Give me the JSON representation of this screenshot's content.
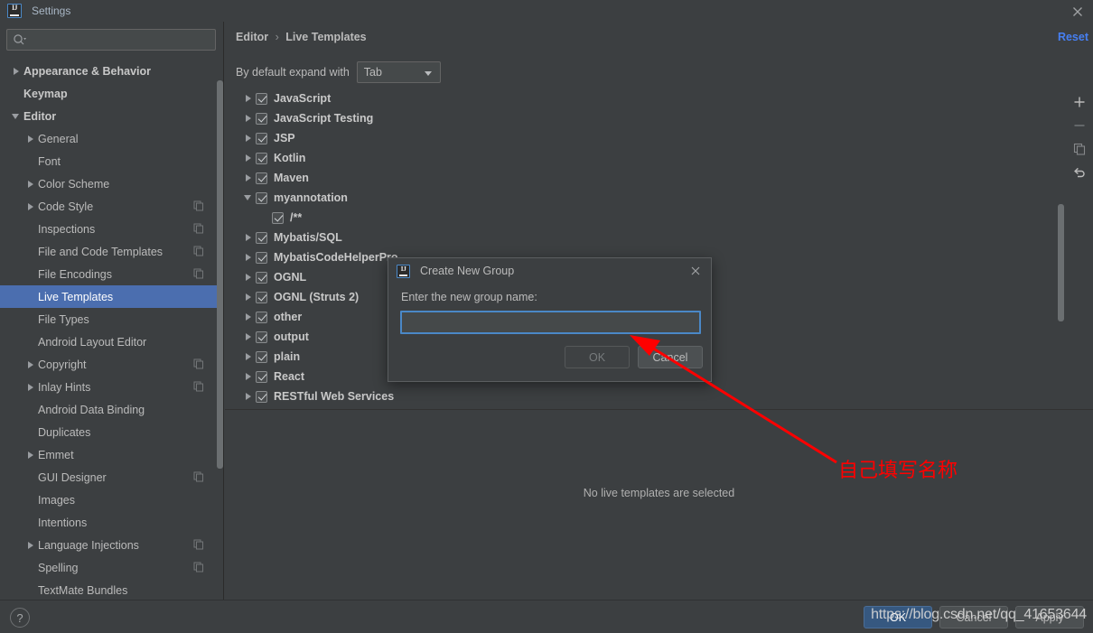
{
  "window": {
    "title": "Settings",
    "logo_icon": "intellij-idea-icon",
    "close_icon": "close-icon"
  },
  "sidebar": {
    "search": {
      "placeholder": "",
      "value": "",
      "icon": "search-icon"
    },
    "items": [
      {
        "label": "Appearance & Behavior",
        "arrow": "closed",
        "indent": 0,
        "bold": true,
        "selected": false,
        "copy": false
      },
      {
        "label": "Keymap",
        "arrow": "none",
        "indent": 0,
        "bold": true,
        "selected": false,
        "copy": false
      },
      {
        "label": "Editor",
        "arrow": "open",
        "indent": 0,
        "bold": true,
        "selected": false,
        "copy": false
      },
      {
        "label": "General",
        "arrow": "closed",
        "indent": 1,
        "bold": false,
        "selected": false,
        "copy": false
      },
      {
        "label": "Font",
        "arrow": "none",
        "indent": 1,
        "bold": false,
        "selected": false,
        "copy": false
      },
      {
        "label": "Color Scheme",
        "arrow": "closed",
        "indent": 1,
        "bold": false,
        "selected": false,
        "copy": false
      },
      {
        "label": "Code Style",
        "arrow": "closed",
        "indent": 1,
        "bold": false,
        "selected": false,
        "copy": true
      },
      {
        "label": "Inspections",
        "arrow": "none",
        "indent": 1,
        "bold": false,
        "selected": false,
        "copy": true
      },
      {
        "label": "File and Code Templates",
        "arrow": "none",
        "indent": 1,
        "bold": false,
        "selected": false,
        "copy": true
      },
      {
        "label": "File Encodings",
        "arrow": "none",
        "indent": 1,
        "bold": false,
        "selected": false,
        "copy": true
      },
      {
        "label": "Live Templates",
        "arrow": "none",
        "indent": 1,
        "bold": false,
        "selected": true,
        "copy": false
      },
      {
        "label": "File Types",
        "arrow": "none",
        "indent": 1,
        "bold": false,
        "selected": false,
        "copy": false
      },
      {
        "label": "Android Layout Editor",
        "arrow": "none",
        "indent": 1,
        "bold": false,
        "selected": false,
        "copy": false
      },
      {
        "label": "Copyright",
        "arrow": "closed",
        "indent": 1,
        "bold": false,
        "selected": false,
        "copy": true
      },
      {
        "label": "Inlay Hints",
        "arrow": "closed",
        "indent": 1,
        "bold": false,
        "selected": false,
        "copy": true
      },
      {
        "label": "Android Data Binding",
        "arrow": "none",
        "indent": 1,
        "bold": false,
        "selected": false,
        "copy": false
      },
      {
        "label": "Duplicates",
        "arrow": "none",
        "indent": 1,
        "bold": false,
        "selected": false,
        "copy": false
      },
      {
        "label": "Emmet",
        "arrow": "closed",
        "indent": 1,
        "bold": false,
        "selected": false,
        "copy": false
      },
      {
        "label": "GUI Designer",
        "arrow": "none",
        "indent": 1,
        "bold": false,
        "selected": false,
        "copy": true
      },
      {
        "label": "Images",
        "arrow": "none",
        "indent": 1,
        "bold": false,
        "selected": false,
        "copy": false
      },
      {
        "label": "Intentions",
        "arrow": "none",
        "indent": 1,
        "bold": false,
        "selected": false,
        "copy": false
      },
      {
        "label": "Language Injections",
        "arrow": "closed",
        "indent": 1,
        "bold": false,
        "selected": false,
        "copy": true
      },
      {
        "label": "Spelling",
        "arrow": "none",
        "indent": 1,
        "bold": false,
        "selected": false,
        "copy": true
      },
      {
        "label": "TextMate Bundles",
        "arrow": "none",
        "indent": 1,
        "bold": false,
        "selected": false,
        "copy": false
      }
    ]
  },
  "main": {
    "breadcrumb": {
      "parent": "Editor",
      "separator": "›",
      "current": "Live Templates"
    },
    "reset_label": "Reset",
    "expand_label": "By default expand with",
    "expand_value": "Tab",
    "empty_message": "No live templates are selected",
    "toolbar": [
      {
        "name": "add-button",
        "icon": "plus-icon",
        "enabled": true
      },
      {
        "name": "remove-button",
        "icon": "minus-icon",
        "enabled": false
      },
      {
        "name": "duplicate-button",
        "icon": "copy-icon",
        "enabled": false
      },
      {
        "name": "revert-button",
        "icon": "undo-icon",
        "enabled": true
      }
    ],
    "templates": [
      {
        "label": "JavaScript",
        "arrow": "closed",
        "checked": true,
        "indent": 0
      },
      {
        "label": "JavaScript Testing",
        "arrow": "closed",
        "checked": true,
        "indent": 0
      },
      {
        "label": "JSP",
        "arrow": "closed",
        "checked": true,
        "indent": 0
      },
      {
        "label": "Kotlin",
        "arrow": "closed",
        "checked": true,
        "indent": 0
      },
      {
        "label": "Maven",
        "arrow": "closed",
        "checked": true,
        "indent": 0
      },
      {
        "label": "myannotation",
        "arrow": "open",
        "checked": true,
        "indent": 0
      },
      {
        "label": "/**",
        "arrow": "none",
        "checked": true,
        "indent": 1
      },
      {
        "label": "Mybatis/SQL",
        "arrow": "closed",
        "checked": true,
        "indent": 0
      },
      {
        "label": "MybatisCodeHelperPro",
        "arrow": "closed",
        "checked": true,
        "indent": 0
      },
      {
        "label": "OGNL",
        "arrow": "closed",
        "checked": true,
        "indent": 0
      },
      {
        "label": "OGNL (Struts 2)",
        "arrow": "closed",
        "checked": true,
        "indent": 0
      },
      {
        "label": "other",
        "arrow": "closed",
        "checked": true,
        "indent": 0
      },
      {
        "label": "output",
        "arrow": "closed",
        "checked": true,
        "indent": 0
      },
      {
        "label": "plain",
        "arrow": "closed",
        "checked": true,
        "indent": 0
      },
      {
        "label": "React",
        "arrow": "closed",
        "checked": true,
        "indent": 0
      },
      {
        "label": "RESTful Web Services",
        "arrow": "closed",
        "checked": true,
        "indent": 0
      }
    ]
  },
  "dialog": {
    "title": "Create New Group",
    "logo_icon": "intellij-idea-icon",
    "close_icon": "close-icon",
    "prompt": "Enter the new group name:",
    "input_value": "",
    "input_placeholder": "",
    "ok_label": "OK",
    "cancel_label": "Cancel",
    "ok_enabled": false
  },
  "annotation": {
    "text": "自己填写名称",
    "color": "#ff0000",
    "arrow_icon": "arrow-pointer-icon"
  },
  "bottom": {
    "help_label": "?",
    "buttons": [
      {
        "label": "OK",
        "default": true
      },
      {
        "label": "Cancel",
        "default": false
      },
      {
        "label": "Apply",
        "default": false
      }
    ],
    "watermark": "https://blog.csdn.net/qq_41653644"
  },
  "colors": {
    "background": "#3c3f41",
    "selection": "#4b6eaf",
    "accent_link": "#467ff2",
    "dialog_focus": "#4a88c7",
    "annotation": "#ff0000",
    "default_button": "#365880"
  }
}
